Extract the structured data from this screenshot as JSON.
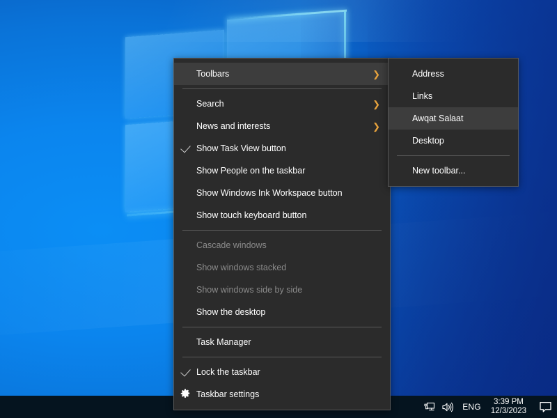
{
  "desktop": {
    "wallpaper_name": "windows-10-hero-wallpaper",
    "colors": {
      "wallpaper_light_blue": "#0b8ef5",
      "wallpaper_dark_blue": "#0c4fae",
      "pane_glow": "#96ebff"
    }
  },
  "taskbar": {
    "background_color": "#05141f",
    "tray": {
      "network_icon": "network-monitor-icon",
      "volume_icon": "volume-speaker-icon",
      "language": "ENG",
      "clock": {
        "time": "3:39 PM",
        "date": "12/3/2023"
      },
      "notifications_icon": "notification-speech-bubble-icon"
    }
  },
  "context_menu": {
    "name": "taskbar-context-menu",
    "background_color": "#2b2b2b",
    "highlight_color": "#3d3d3d",
    "text_color": "#ffffff",
    "disabled_text_color": "#8a8a8a",
    "chevron_color": "#e8a33d",
    "items": [
      {
        "label": "Toolbars",
        "submenu": true,
        "highlight": true,
        "checked": false,
        "disabled": false,
        "icon": null
      },
      {
        "separator": true
      },
      {
        "label": "Search",
        "submenu": true,
        "highlight": false,
        "checked": false,
        "disabled": false,
        "icon": null
      },
      {
        "label": "News and interests",
        "submenu": true,
        "highlight": false,
        "checked": false,
        "disabled": false,
        "icon": null
      },
      {
        "label": "Show Task View button",
        "submenu": false,
        "highlight": false,
        "checked": true,
        "disabled": false,
        "icon": null
      },
      {
        "label": "Show People on the taskbar",
        "submenu": false,
        "highlight": false,
        "checked": false,
        "disabled": false,
        "icon": null
      },
      {
        "label": "Show Windows Ink Workspace button",
        "submenu": false,
        "highlight": false,
        "checked": false,
        "disabled": false,
        "icon": null
      },
      {
        "label": "Show touch keyboard button",
        "submenu": false,
        "highlight": false,
        "checked": false,
        "disabled": false,
        "icon": null
      },
      {
        "separator": true
      },
      {
        "label": "Cascade windows",
        "submenu": false,
        "highlight": false,
        "checked": false,
        "disabled": true,
        "icon": null
      },
      {
        "label": "Show windows stacked",
        "submenu": false,
        "highlight": false,
        "checked": false,
        "disabled": true,
        "icon": null
      },
      {
        "label": "Show windows side by side",
        "submenu": false,
        "highlight": false,
        "checked": false,
        "disabled": true,
        "icon": null
      },
      {
        "label": "Show the desktop",
        "submenu": false,
        "highlight": false,
        "checked": false,
        "disabled": false,
        "icon": null
      },
      {
        "separator": true
      },
      {
        "label": "Task Manager",
        "submenu": false,
        "highlight": false,
        "checked": false,
        "disabled": false,
        "icon": null
      },
      {
        "separator": true
      },
      {
        "label": "Lock the taskbar",
        "submenu": false,
        "highlight": false,
        "checked": true,
        "disabled": false,
        "icon": null
      },
      {
        "label": "Taskbar settings",
        "submenu": false,
        "highlight": false,
        "checked": false,
        "disabled": false,
        "icon": "gear-icon"
      }
    ]
  },
  "toolbars_submenu": {
    "name": "toolbars-submenu",
    "items": [
      {
        "label": "Address",
        "highlight": false
      },
      {
        "label": "Links",
        "highlight": false
      },
      {
        "label": "Awqat Salaat",
        "highlight": true
      },
      {
        "label": "Desktop",
        "highlight": false
      },
      {
        "separator": true
      },
      {
        "label": "New toolbar...",
        "highlight": false
      }
    ]
  }
}
